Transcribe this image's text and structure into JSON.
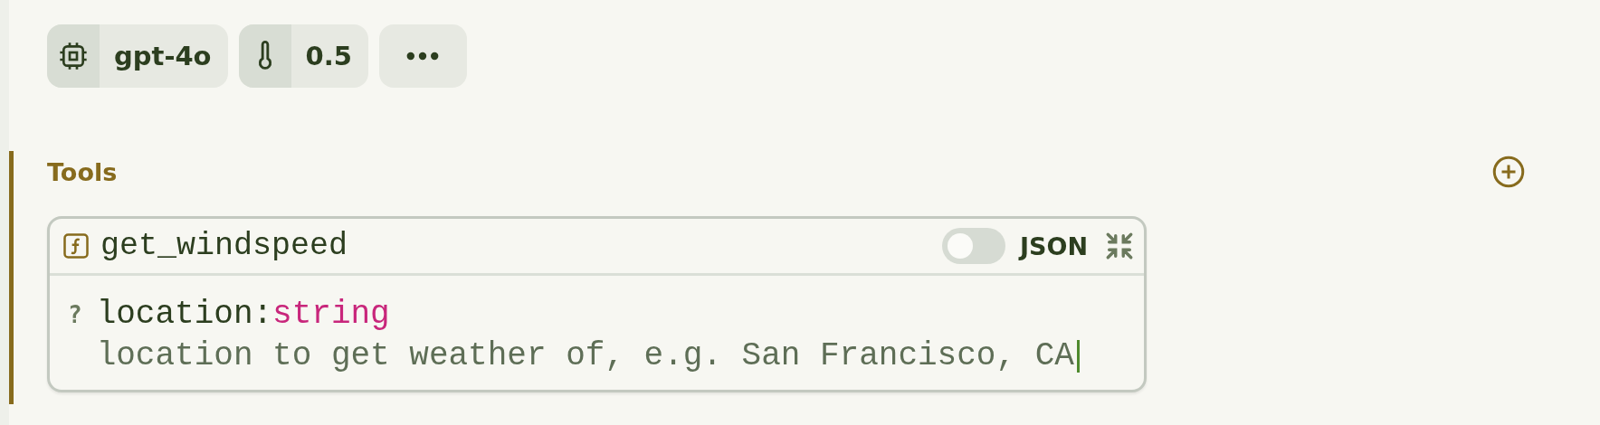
{
  "chips": [
    {
      "kind": "model",
      "label": "gpt-4o"
    },
    {
      "kind": "temperature",
      "label": "0.5"
    },
    {
      "kind": "more"
    }
  ],
  "tools_section": {
    "title": "Tools",
    "tools": [
      {
        "name": "get_windspeed",
        "json_mode": false,
        "json_label": "JSON",
        "expanded": true,
        "params": [
          {
            "optional_mark": "?",
            "name": "location",
            "separator": ":",
            "type": "string",
            "description": "location to get weather of, e.g. San Francisco, CA",
            "focused": true
          }
        ]
      }
    ]
  }
}
